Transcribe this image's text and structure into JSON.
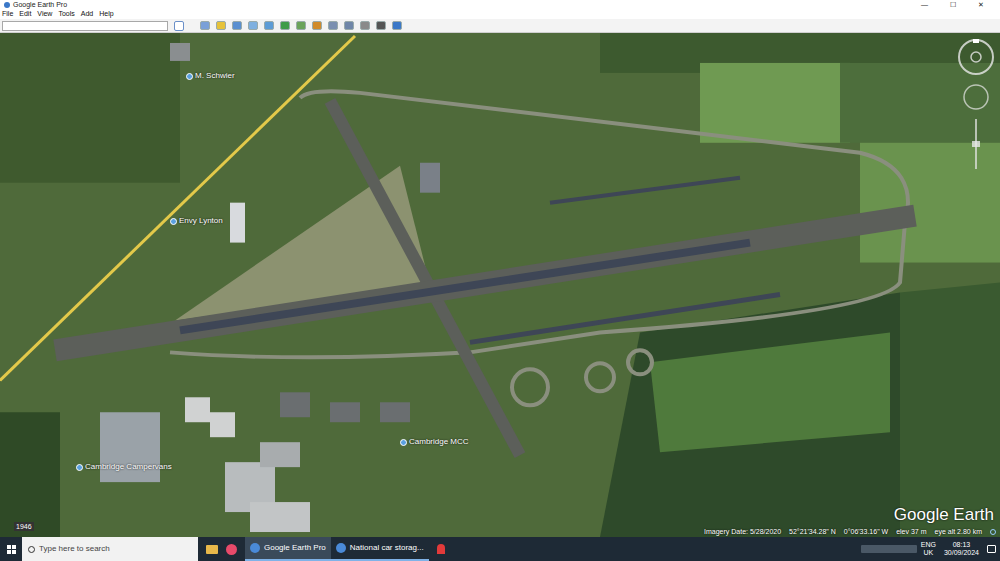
{
  "window": {
    "title": "Google Earth Pro",
    "controls": [
      "—",
      "☐",
      "✕"
    ]
  },
  "menu": [
    "File",
    "Edit",
    "View",
    "Tools",
    "Add",
    "Help"
  ],
  "search": {
    "value": ""
  },
  "map": {
    "places": [
      {
        "label": "M. Schwier"
      },
      {
        "label": "Envy Lynton"
      },
      {
        "label": "Cambridge Campervans"
      },
      {
        "label": "Cambridge MCC"
      }
    ],
    "history_year": "1946",
    "logo": "Google Earth",
    "status": {
      "imagery_date": "Imagery Date: 5/28/2020",
      "lat": "52°21'34.28\" N",
      "lon": "0°06'33.16\" W",
      "elev": "elev  37 m",
      "eye_alt": "eye alt  2.80 km"
    }
  },
  "taskbar": {
    "search_placeholder": "Type here to search",
    "apps": [
      {
        "label": "Google Earth Pro",
        "selected": true
      },
      {
        "label": "National car storag...",
        "selected": false
      }
    ],
    "lang": "ENG",
    "region": "UK",
    "time": "08:13",
    "date": "30/09/2024"
  }
}
